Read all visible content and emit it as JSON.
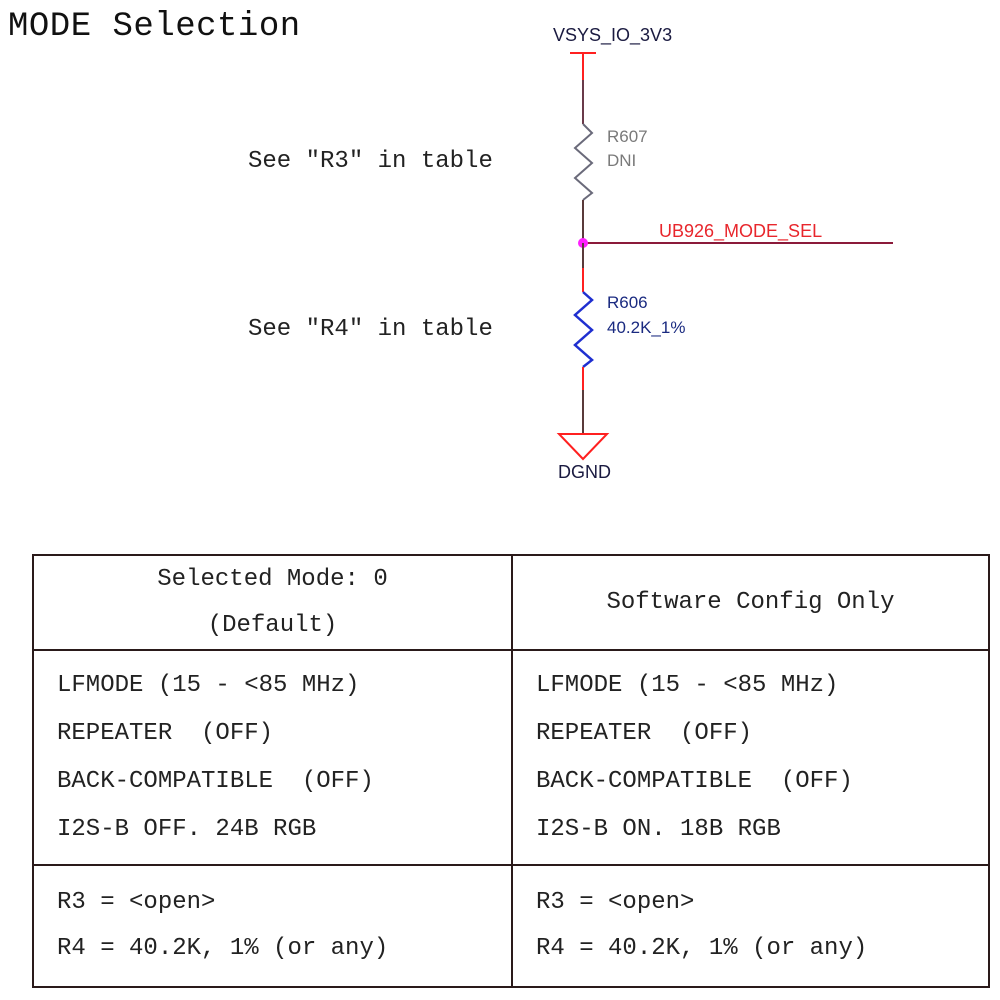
{
  "title": "MODE Selection",
  "notes": {
    "upper": "See \"R3\" in table",
    "lower": "See \"R4\" in table"
  },
  "schematic": {
    "power_rail": "VSYS_IO_3V3",
    "net": "UB926_MODE_SEL",
    "ground": "DGND",
    "resistors": [
      {
        "ref": "R607",
        "value": "DNI",
        "color": "#7a7a7a"
      },
      {
        "ref": "R606",
        "value": "40.2K_1%",
        "color": "#1f2fd0"
      }
    ],
    "colors": {
      "wire": "#8b1a3a",
      "pin": "#ff2020",
      "junction": "#ff20ff"
    }
  },
  "table": {
    "columns": [
      {
        "header": [
          "Selected Mode: 0",
          "(Default)"
        ],
        "settings": [
          "LFMODE (15 - <85 MHz)",
          "REPEATER  (OFF)",
          "BACK-COMPATIBLE  (OFF)",
          "I2S-B OFF. 24B RGB"
        ],
        "resistors": [
          "R3 = <open>",
          "R4 = 40.2K, 1% (or any)"
        ]
      },
      {
        "header": [
          "Software Config Only"
        ],
        "settings": [
          "LFMODE (15 - <85 MHz)",
          "REPEATER  (OFF)",
          "BACK-COMPATIBLE  (OFF)",
          "I2S-B ON. 18B RGB"
        ],
        "resistors": [
          "R3 = <open>",
          "R4 = 40.2K, 1% (or any)"
        ]
      }
    ]
  }
}
